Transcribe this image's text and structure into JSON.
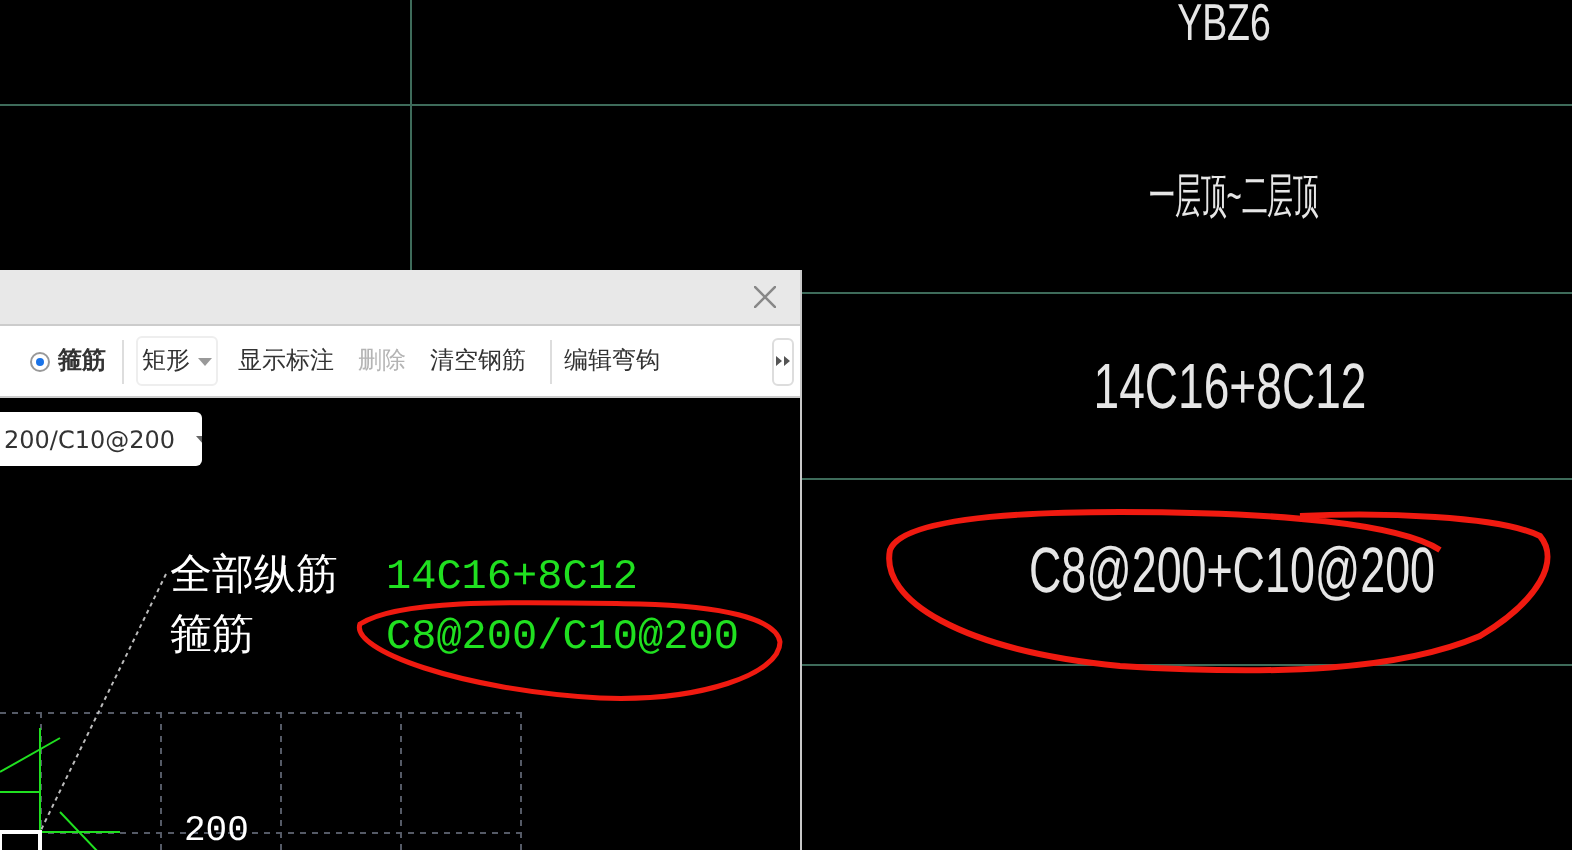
{
  "table": {
    "cells": [
      "YBZ6",
      "一层顶~二层顶",
      "14C16+8C12",
      "C8@200+C10@200"
    ]
  },
  "dialog": {
    "toolbar": [
      {
        "kind": "radio",
        "label": "箍筋",
        "selected": true
      },
      {
        "kind": "separator"
      },
      {
        "kind": "dropdown",
        "label": "矩形"
      },
      {
        "kind": "button",
        "label": "显示标注",
        "disabled": false
      },
      {
        "kind": "button",
        "label": "删除",
        "disabled": true
      },
      {
        "kind": "button",
        "label": "清空钢筋",
        "disabled": false
      },
      {
        "kind": "separator"
      },
      {
        "kind": "button",
        "label": "编辑弯钩",
        "disabled": false
      }
    ],
    "combo": {
      "value": "200/C10@200"
    },
    "canvas": {
      "labels": [
        {
          "name": "全部纵筋",
          "value": "14C16+8C12"
        },
        {
          "name": "箍筋",
          "value": "C8@200/C10@200"
        }
      ],
      "dimension": "200"
    }
  }
}
